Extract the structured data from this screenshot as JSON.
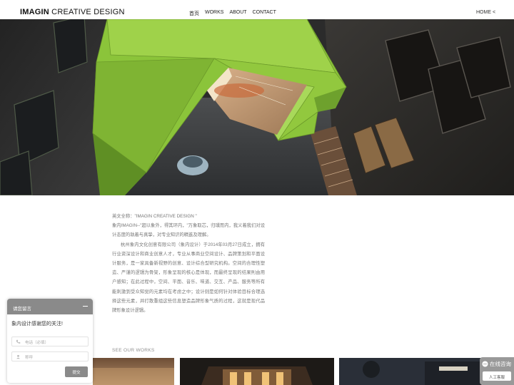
{
  "header": {
    "logo_bold": "IMAGIN",
    "logo_rest": " CREATIVE DESIGN",
    "nav": [
      {
        "label": "首页"
      },
      {
        "label": "WORKS"
      },
      {
        "label": "ABOUT"
      },
      {
        "label": "CONTACT"
      }
    ],
    "home_link": "HOME <"
  },
  "intro": {
    "english_name": "英文全称：\"IMAGIN CREATIVE DESIGN \"",
    "slogan": "象内IMAGIN--\"超以象外，得其环内，\"万象取芯，归璞而内，我义着我们对设计态度的執着与真挚，对专业知识的精進及理解。",
    "body": "杭州象内文化创意有限公司（象内设计）于2014年03月27日成立，拥有行业资深设计和商业创意人才，专业从事商业空间设计、品牌策划和平面设计服务，是一家具备新视野的创意、设计综合型研究机构。空间的合理性塑造、严谨的逻辑为骨架，形象呈现的核心是体现，而最终呈现的结果則由用户感知；在此过程中，空间、平面、音乐、味道、交互、产品、服务等所有能刺激到受众知觉的元素均在考虑之中；设计则是如何针对体验目标合理选择这些元素，并打散重组这些信息塑造品牌形象气质的过程，这就是现代品牌形象设计逻辑。"
  },
  "see_works": "SEE OUR WORKS",
  "message_panel": {
    "title": "请您留言",
    "greeting": "象内设计感谢您的关注!",
    "phone_placeholder": "电话（必填）",
    "name_placeholder": "称呼",
    "submit": "提交"
  },
  "consult": {
    "title": "在线咨询",
    "button": "人工客服"
  },
  "colors": {
    "hero_green": "#8bc43a",
    "panel_gray": "#8a8a8a"
  }
}
